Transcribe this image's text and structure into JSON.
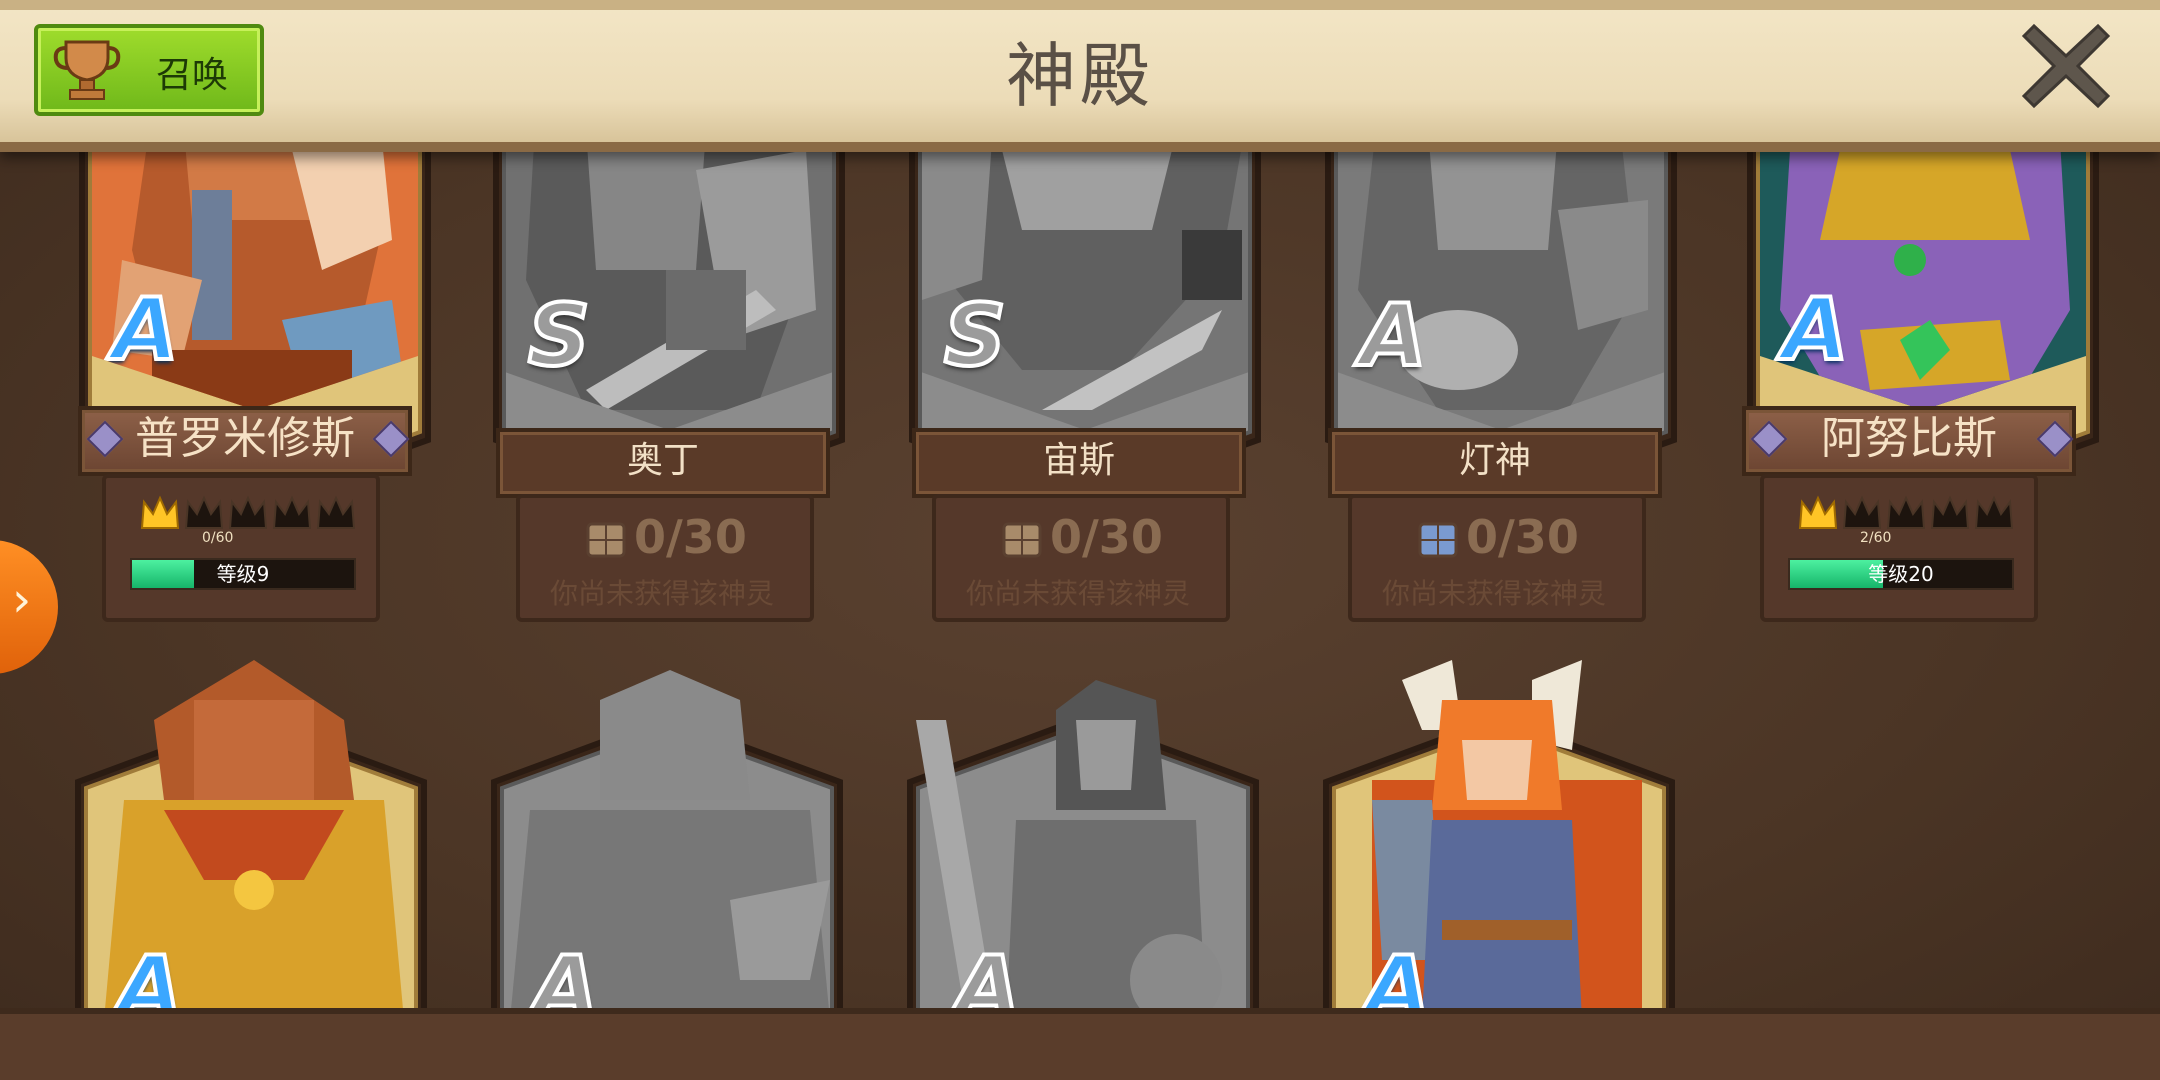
{
  "header": {
    "title": "神殿",
    "summon_label": "召唤"
  },
  "icons": {
    "summon": "trophy-icon",
    "close": "close-x-icon",
    "side_tab": "chevron-right-icon"
  },
  "colors": {
    "accent_green": "#7bc61e",
    "tab_orange": "#f07a14",
    "rank_blue": "#3ba7ff",
    "level_green": "#22c878"
  },
  "gods": [
    {
      "name": "普罗米修斯",
      "rank": "A",
      "owned": true,
      "stars": "0/60",
      "crowns_filled": 1,
      "crowns_total": 5,
      "level_label": "等级9",
      "level_fill": 0.28
    },
    {
      "name": "奥丁",
      "rank": "S",
      "owned": false,
      "fragments": "0/30",
      "hint": "你尚未获得该神灵"
    },
    {
      "name": "宙斯",
      "rank": "S",
      "owned": false,
      "fragments": "0/30",
      "hint": "你尚未获得该神灵"
    },
    {
      "name": "灯神",
      "rank": "A",
      "owned": false,
      "fragments": "0/30",
      "hint": "你尚未获得该神灵"
    },
    {
      "name": "阿努比斯",
      "rank": "A",
      "owned": true,
      "stars": "2/60",
      "crowns_filled": 1,
      "crowns_total": 5,
      "level_label": "等级20",
      "level_fill": 0.42
    }
  ],
  "row2": [
    {
      "rank": "A",
      "owned": true
    },
    {
      "rank": "A",
      "owned": false
    },
    {
      "rank": "A",
      "owned": false
    },
    {
      "rank": "A",
      "owned": true
    }
  ]
}
